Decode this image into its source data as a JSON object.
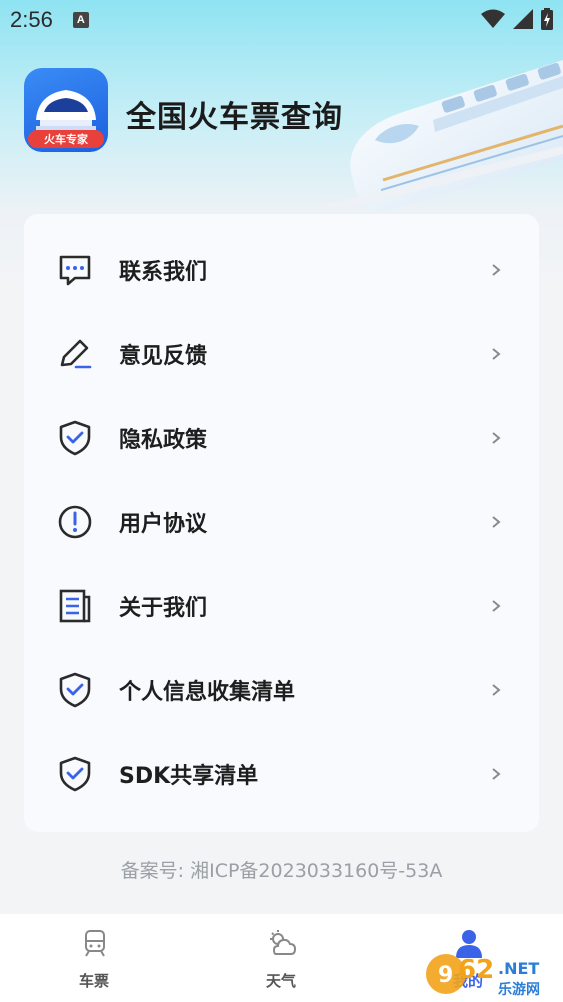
{
  "status_bar": {
    "time": "2:56",
    "notification_letter": "A",
    "icons": [
      "wifi-icon",
      "signal-icon",
      "battery-icon"
    ]
  },
  "header": {
    "logo_badge": "火车专家",
    "title": "全国火车票查询"
  },
  "menu": {
    "items": [
      {
        "label": "联系我们",
        "icon": "chat-icon"
      },
      {
        "label": "意见反馈",
        "icon": "edit-icon"
      },
      {
        "label": "隐私政策",
        "icon": "shield-check-icon"
      },
      {
        "label": "用户协议",
        "icon": "exclamation-circle-icon"
      },
      {
        "label": "关于我们",
        "icon": "document-icon"
      },
      {
        "label": "个人信息收集清单",
        "icon": "shield-check-icon"
      },
      {
        "label": "SDK共享清单",
        "icon": "shield-check-icon"
      }
    ]
  },
  "footer": {
    "record": "备案号: 湘ICP备2023033160号-53A"
  },
  "tab_bar": {
    "tabs": [
      {
        "label": "车票",
        "icon": "train-icon"
      },
      {
        "label": "天气",
        "icon": "weather-icon"
      },
      {
        "label": "我的",
        "icon": "person-icon"
      }
    ],
    "active_index": 2
  },
  "colors": {
    "accent": "#3a63e8",
    "icon_stroke": "#2b2b2b",
    "hero_top": "#8fe3f2",
    "logo_blue": "#1c5fe0",
    "badge_red": "#e8403a"
  }
}
